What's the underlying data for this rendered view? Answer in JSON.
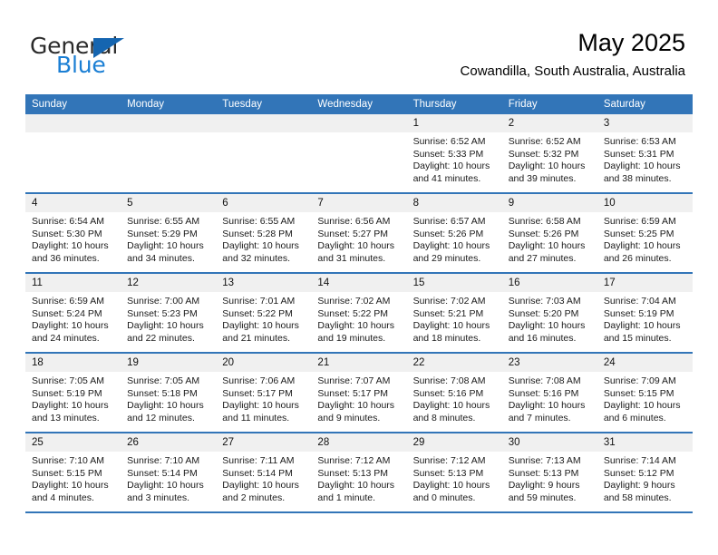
{
  "brand": {
    "name_part1": "General",
    "name_part2": "Blue",
    "color_dark": "#2b2b2b",
    "color_blue": "#1b7fd4",
    "triangle_color": "#1565b0"
  },
  "header": {
    "title": "May 2025",
    "subtitle": "Cowandilla, South Australia, Australia"
  },
  "calendar": {
    "header_bg": "#3275b8",
    "header_text_color": "#ffffff",
    "day_band_bg": "#f0f0f0",
    "weekdays": [
      "Sunday",
      "Monday",
      "Tuesday",
      "Wednesday",
      "Thursday",
      "Friday",
      "Saturday"
    ],
    "weeks": [
      [
        {
          "day": "",
          "empty": true
        },
        {
          "day": "",
          "empty": true
        },
        {
          "day": "",
          "empty": true
        },
        {
          "day": "",
          "empty": true
        },
        {
          "day": "1",
          "sunrise": "Sunrise: 6:52 AM",
          "sunset": "Sunset: 5:33 PM",
          "daylight_line1": "Daylight: 10 hours",
          "daylight_line2": "and 41 minutes."
        },
        {
          "day": "2",
          "sunrise": "Sunrise: 6:52 AM",
          "sunset": "Sunset: 5:32 PM",
          "daylight_line1": "Daylight: 10 hours",
          "daylight_line2": "and 39 minutes."
        },
        {
          "day": "3",
          "sunrise": "Sunrise: 6:53 AM",
          "sunset": "Sunset: 5:31 PM",
          "daylight_line1": "Daylight: 10 hours",
          "daylight_line2": "and 38 minutes."
        }
      ],
      [
        {
          "day": "4",
          "sunrise": "Sunrise: 6:54 AM",
          "sunset": "Sunset: 5:30 PM",
          "daylight_line1": "Daylight: 10 hours",
          "daylight_line2": "and 36 minutes."
        },
        {
          "day": "5",
          "sunrise": "Sunrise: 6:55 AM",
          "sunset": "Sunset: 5:29 PM",
          "daylight_line1": "Daylight: 10 hours",
          "daylight_line2": "and 34 minutes."
        },
        {
          "day": "6",
          "sunrise": "Sunrise: 6:55 AM",
          "sunset": "Sunset: 5:28 PM",
          "daylight_line1": "Daylight: 10 hours",
          "daylight_line2": "and 32 minutes."
        },
        {
          "day": "7",
          "sunrise": "Sunrise: 6:56 AM",
          "sunset": "Sunset: 5:27 PM",
          "daylight_line1": "Daylight: 10 hours",
          "daylight_line2": "and 31 minutes."
        },
        {
          "day": "8",
          "sunrise": "Sunrise: 6:57 AM",
          "sunset": "Sunset: 5:26 PM",
          "daylight_line1": "Daylight: 10 hours",
          "daylight_line2": "and 29 minutes."
        },
        {
          "day": "9",
          "sunrise": "Sunrise: 6:58 AM",
          "sunset": "Sunset: 5:26 PM",
          "daylight_line1": "Daylight: 10 hours",
          "daylight_line2": "and 27 minutes."
        },
        {
          "day": "10",
          "sunrise": "Sunrise: 6:59 AM",
          "sunset": "Sunset: 5:25 PM",
          "daylight_line1": "Daylight: 10 hours",
          "daylight_line2": "and 26 minutes."
        }
      ],
      [
        {
          "day": "11",
          "sunrise": "Sunrise: 6:59 AM",
          "sunset": "Sunset: 5:24 PM",
          "daylight_line1": "Daylight: 10 hours",
          "daylight_line2": "and 24 minutes."
        },
        {
          "day": "12",
          "sunrise": "Sunrise: 7:00 AM",
          "sunset": "Sunset: 5:23 PM",
          "daylight_line1": "Daylight: 10 hours",
          "daylight_line2": "and 22 minutes."
        },
        {
          "day": "13",
          "sunrise": "Sunrise: 7:01 AM",
          "sunset": "Sunset: 5:22 PM",
          "daylight_line1": "Daylight: 10 hours",
          "daylight_line2": "and 21 minutes."
        },
        {
          "day": "14",
          "sunrise": "Sunrise: 7:02 AM",
          "sunset": "Sunset: 5:22 PM",
          "daylight_line1": "Daylight: 10 hours",
          "daylight_line2": "and 19 minutes."
        },
        {
          "day": "15",
          "sunrise": "Sunrise: 7:02 AM",
          "sunset": "Sunset: 5:21 PM",
          "daylight_line1": "Daylight: 10 hours",
          "daylight_line2": "and 18 minutes."
        },
        {
          "day": "16",
          "sunrise": "Sunrise: 7:03 AM",
          "sunset": "Sunset: 5:20 PM",
          "daylight_line1": "Daylight: 10 hours",
          "daylight_line2": "and 16 minutes."
        },
        {
          "day": "17",
          "sunrise": "Sunrise: 7:04 AM",
          "sunset": "Sunset: 5:19 PM",
          "daylight_line1": "Daylight: 10 hours",
          "daylight_line2": "and 15 minutes."
        }
      ],
      [
        {
          "day": "18",
          "sunrise": "Sunrise: 7:05 AM",
          "sunset": "Sunset: 5:19 PM",
          "daylight_line1": "Daylight: 10 hours",
          "daylight_line2": "and 13 minutes."
        },
        {
          "day": "19",
          "sunrise": "Sunrise: 7:05 AM",
          "sunset": "Sunset: 5:18 PM",
          "daylight_line1": "Daylight: 10 hours",
          "daylight_line2": "and 12 minutes."
        },
        {
          "day": "20",
          "sunrise": "Sunrise: 7:06 AM",
          "sunset": "Sunset: 5:17 PM",
          "daylight_line1": "Daylight: 10 hours",
          "daylight_line2": "and 11 minutes."
        },
        {
          "day": "21",
          "sunrise": "Sunrise: 7:07 AM",
          "sunset": "Sunset: 5:17 PM",
          "daylight_line1": "Daylight: 10 hours",
          "daylight_line2": "and 9 minutes."
        },
        {
          "day": "22",
          "sunrise": "Sunrise: 7:08 AM",
          "sunset": "Sunset: 5:16 PM",
          "daylight_line1": "Daylight: 10 hours",
          "daylight_line2": "and 8 minutes."
        },
        {
          "day": "23",
          "sunrise": "Sunrise: 7:08 AM",
          "sunset": "Sunset: 5:16 PM",
          "daylight_line1": "Daylight: 10 hours",
          "daylight_line2": "and 7 minutes."
        },
        {
          "day": "24",
          "sunrise": "Sunrise: 7:09 AM",
          "sunset": "Sunset: 5:15 PM",
          "daylight_line1": "Daylight: 10 hours",
          "daylight_line2": "and 6 minutes."
        }
      ],
      [
        {
          "day": "25",
          "sunrise": "Sunrise: 7:10 AM",
          "sunset": "Sunset: 5:15 PM",
          "daylight_line1": "Daylight: 10 hours",
          "daylight_line2": "and 4 minutes."
        },
        {
          "day": "26",
          "sunrise": "Sunrise: 7:10 AM",
          "sunset": "Sunset: 5:14 PM",
          "daylight_line1": "Daylight: 10 hours",
          "daylight_line2": "and 3 minutes."
        },
        {
          "day": "27",
          "sunrise": "Sunrise: 7:11 AM",
          "sunset": "Sunset: 5:14 PM",
          "daylight_line1": "Daylight: 10 hours",
          "daylight_line2": "and 2 minutes."
        },
        {
          "day": "28",
          "sunrise": "Sunrise: 7:12 AM",
          "sunset": "Sunset: 5:13 PM",
          "daylight_line1": "Daylight: 10 hours",
          "daylight_line2": "and 1 minute."
        },
        {
          "day": "29",
          "sunrise": "Sunrise: 7:12 AM",
          "sunset": "Sunset: 5:13 PM",
          "daylight_line1": "Daylight: 10 hours",
          "daylight_line2": "and 0 minutes."
        },
        {
          "day": "30",
          "sunrise": "Sunrise: 7:13 AM",
          "sunset": "Sunset: 5:13 PM",
          "daylight_line1": "Daylight: 9 hours",
          "daylight_line2": "and 59 minutes."
        },
        {
          "day": "31",
          "sunrise": "Sunrise: 7:14 AM",
          "sunset": "Sunset: 5:12 PM",
          "daylight_line1": "Daylight: 9 hours",
          "daylight_line2": "and 58 minutes."
        }
      ]
    ]
  }
}
